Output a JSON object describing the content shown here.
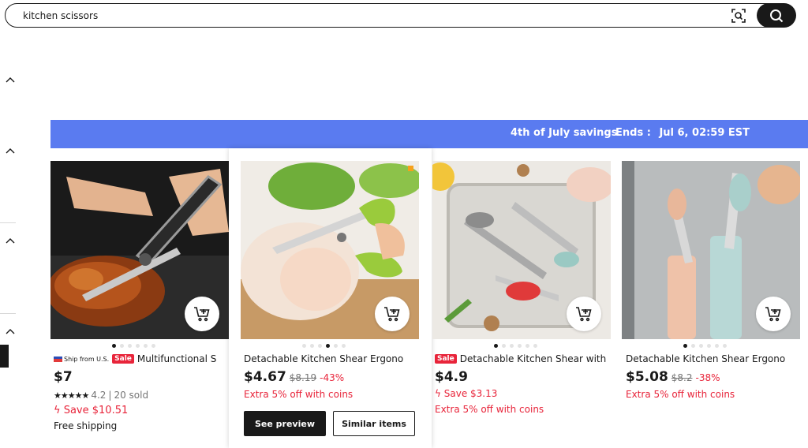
{
  "search": {
    "value": "kitchen scissors"
  },
  "banner": {
    "promo": "4th of July savings",
    "ends_label": "Ends :",
    "ends_time": "Jul 6, 02:59 EST"
  },
  "products": [
    {
      "ship_badge": "Ship from U.S.",
      "sale_badge": "Sale",
      "title": "Multifunctional S",
      "price": "$7",
      "rating": "4.2",
      "sold": "20 sold",
      "save": "Save $10.51",
      "shipping": "Free shipping",
      "active_dot": 0
    },
    {
      "title": "Detachable Kitchen Shear Ergono",
      "price": "$4.67",
      "orig_price": "$8.19",
      "discount": "-43%",
      "coins": "Extra 5% off with coins",
      "active_dot": 3
    },
    {
      "sale_badge": "Sale",
      "title": "Detachable Kitchen Shear with",
      "price": "$4.9",
      "save": "Save $3.13",
      "coins": "Extra 5% off with coins",
      "active_dot": 0
    },
    {
      "title": "Detachable Kitchen Shear Ergono",
      "price": "$5.08",
      "orig_price": "$8.2",
      "discount": "-38%",
      "coins": "Extra 5% off with coins",
      "active_dot": 0
    }
  ],
  "hover_actions": {
    "preview": "See preview",
    "similar": "Similar items"
  },
  "colors": {
    "banner": "#5a7bf0",
    "accent_red": "#e8243a",
    "dark": "#191919"
  }
}
